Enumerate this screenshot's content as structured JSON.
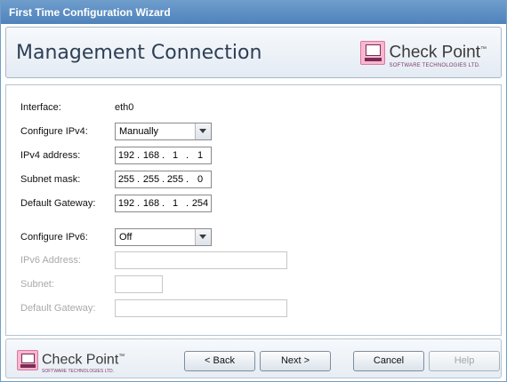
{
  "window": {
    "title": "First Time Configuration Wizard"
  },
  "header": {
    "title": "Management Connection",
    "logo": {
      "name": "Check Point",
      "tm": "™",
      "subtitle": "SOFTWARE TECHNOLOGIES LTD."
    }
  },
  "form": {
    "interface": {
      "label": "Interface:",
      "value": "eth0"
    },
    "configure_ipv4": {
      "label": "Configure IPv4:",
      "value": "Manually"
    },
    "ipv4_address": {
      "label": "IPv4 address:",
      "octets": [
        "192",
        "168",
        "1",
        "1"
      ]
    },
    "subnet_mask": {
      "label": "Subnet mask:",
      "octets": [
        "255",
        "255",
        "255",
        "0"
      ]
    },
    "default_gateway": {
      "label": "Default Gateway:",
      "octets": [
        "192",
        "168",
        "1",
        "254"
      ]
    },
    "configure_ipv6": {
      "label": "Configure IPv6:",
      "value": "Off"
    },
    "ipv6_address": {
      "label": "IPv6 Address:"
    },
    "ipv6_subnet": {
      "label": "Subnet:"
    },
    "ipv6_gateway": {
      "label": "Default Gateway:"
    }
  },
  "footer": {
    "logo": {
      "name": "Check Point",
      "tm": "™",
      "subtitle": "SOFTWARE TECHNOLOGIES LTD."
    },
    "buttons": {
      "back": "< Back",
      "next": "Next >",
      "cancel": "Cancel",
      "help": "Help"
    }
  }
}
